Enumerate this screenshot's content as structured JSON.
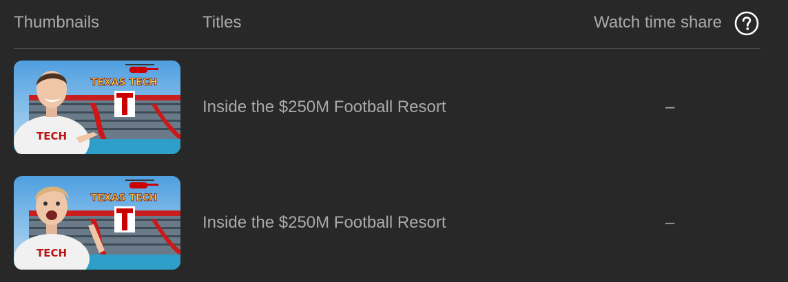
{
  "header": {
    "thumbnails_label": "Thumbnails",
    "titles_label": "Titles",
    "watch_share_label": "Watch time share",
    "help_icon": "help-circle-icon"
  },
  "rows": [
    {
      "title": "Inside the $250M Football Resort",
      "watch_time_share": "–",
      "thumbnail": {
        "sign_text": "TEXAS TECH",
        "shirt_text": "TECH"
      }
    },
    {
      "title": "Inside the $250M Football Resort",
      "watch_time_share": "–",
      "thumbnail": {
        "sign_text": "TEXAS TECH",
        "shirt_text": "TECH"
      }
    }
  ],
  "colors": {
    "background": "#282828",
    "text": "#aaaaaa",
    "divider": "#4a4a4a",
    "brand_red": "#cc0000",
    "sign_yellow": "#f7d23e"
  }
}
